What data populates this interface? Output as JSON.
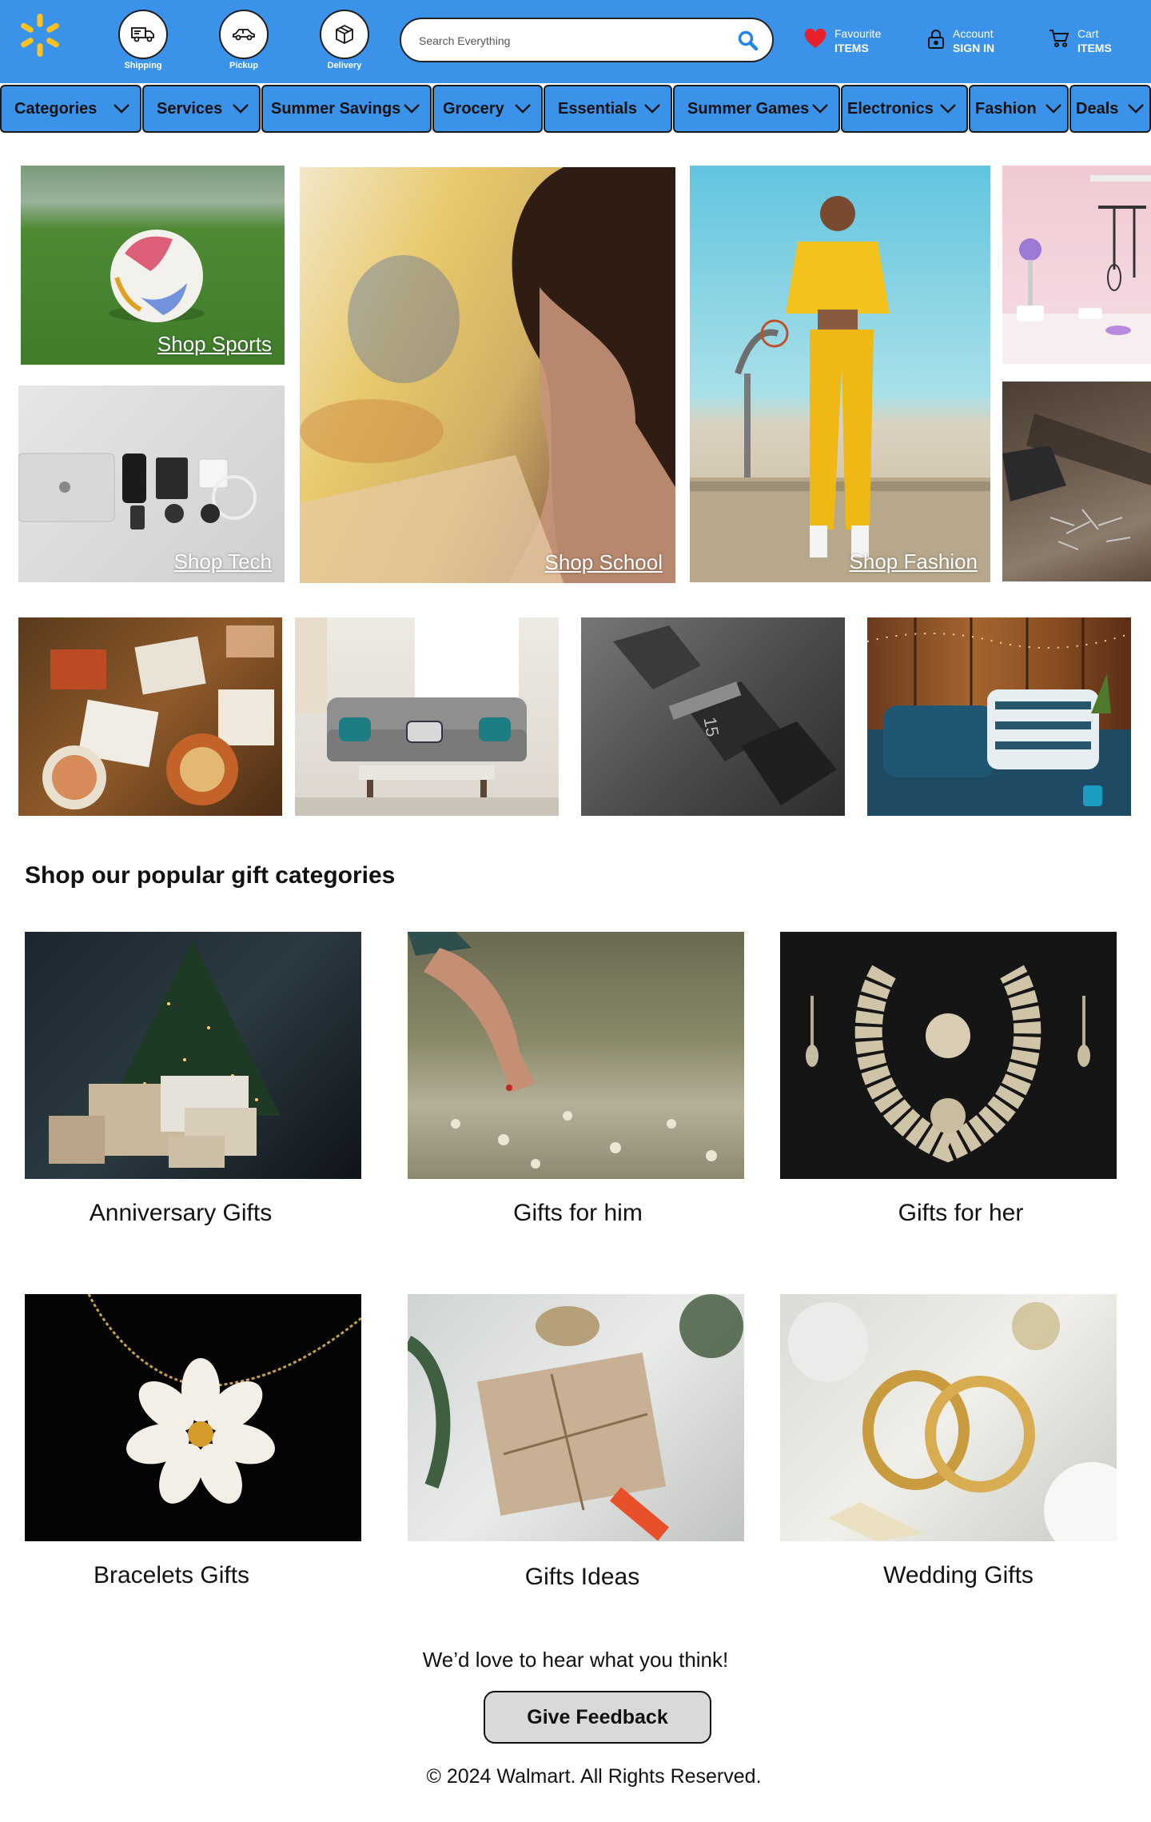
{
  "header": {
    "services": [
      {
        "label": "Shipping",
        "icon": "truck-icon"
      },
      {
        "label": "Pickup",
        "icon": "car-icon"
      },
      {
        "label": "Delivery",
        "icon": "box-icon"
      }
    ],
    "search": {
      "placeholder": "Search Everything"
    },
    "favourite": {
      "title": "Favourite",
      "value": "ITEMS",
      "icon": "heart-icon"
    },
    "account": {
      "title": "Account",
      "value": "SIGN IN",
      "icon": "lock-icon"
    },
    "cart": {
      "title": "Cart",
      "value": "ITEMS",
      "icon": "cart-icon"
    },
    "brand_color": "#3a93e8",
    "logo_color": "#ffc220"
  },
  "nav": [
    {
      "label": "Categories"
    },
    {
      "label": "Services"
    },
    {
      "label": "Summer Savings"
    },
    {
      "label": "Grocery"
    },
    {
      "label": "Essentials"
    },
    {
      "label": "Summer Games"
    },
    {
      "label": "Electronics"
    },
    {
      "label": "Fashion"
    },
    {
      "label": "Deals"
    }
  ],
  "promos": {
    "sports": "Shop Sports",
    "tech": "Shop Tech",
    "school": "Shop School",
    "fashion": "Shop  Fashion"
  },
  "gifts": {
    "title": "Shop our popular gift categories",
    "items": [
      {
        "label": "Anniversary Gifts"
      },
      {
        "label": "Gifts for him"
      },
      {
        "label": "Gifts for her"
      },
      {
        "label": "Bracelets Gifts"
      },
      {
        "label": "Gifts Ideas"
      },
      {
        "label": "Wedding Gifts"
      }
    ]
  },
  "footer": {
    "prompt": "We’d love to hear what you think!",
    "feedback_button": "Give Feedback",
    "copyright": "© 2024 Walmart. All Rights Reserved."
  }
}
